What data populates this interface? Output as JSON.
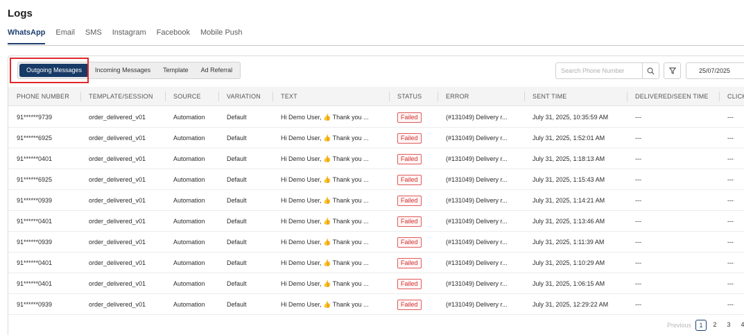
{
  "page": {
    "title": "Logs"
  },
  "channel_tabs": [
    "WhatsApp",
    "Email",
    "SMS",
    "Instagram",
    "Facebook",
    "Mobile Push"
  ],
  "sub_tabs": [
    "Outgoing Messages",
    "Incoming Messages",
    "Template",
    "Ad Referral"
  ],
  "search": {
    "placeholder": "Search Phone Number"
  },
  "date_filter": {
    "value": "25/07/2025"
  },
  "table": {
    "columns": [
      "PHONE NUMBER",
      "TEMPLATE/SESSION",
      "SOURCE",
      "VARIATION",
      "TEXT",
      "STATUS",
      "ERROR",
      "SENT TIME",
      "DELIVERED/SEEN TIME",
      "CLICK"
    ],
    "rows": [
      {
        "phone": "91******9739",
        "template": "order_delivered_v01",
        "source": "Automation",
        "variation": "Default",
        "text_pre": "Hi Demo User,",
        "emoji": "👍",
        "text_post": "Thank you ...",
        "status": "Failed",
        "error": "(#131049) Delivery r...",
        "sent": "July 31, 2025, 10:35:59 AM",
        "delivered": "---",
        "click": "---"
      },
      {
        "phone": "91******6925",
        "template": "order_delivered_v01",
        "source": "Automation",
        "variation": "Default",
        "text_pre": "Hi Demo User,",
        "emoji": "👍",
        "text_post": "Thank you ...",
        "status": "Failed",
        "error": "(#131049) Delivery r...",
        "sent": "July 31, 2025, 1:52:01 AM",
        "delivered": "---",
        "click": "---"
      },
      {
        "phone": "91******0401",
        "template": "order_delivered_v01",
        "source": "Automation",
        "variation": "Default",
        "text_pre": "Hi Demo User,",
        "emoji": "👍",
        "text_post": "Thank you ...",
        "status": "Failed",
        "error": "(#131049) Delivery r...",
        "sent": "July 31, 2025, 1:18:13 AM",
        "delivered": "---",
        "click": "---"
      },
      {
        "phone": "91******6925",
        "template": "order_delivered_v01",
        "source": "Automation",
        "variation": "Default",
        "text_pre": "Hi Demo User,",
        "emoji": "👍",
        "text_post": "Thank you ...",
        "status": "Failed",
        "error": "(#131049) Delivery r...",
        "sent": "July 31, 2025, 1:15:43 AM",
        "delivered": "---",
        "click": "---"
      },
      {
        "phone": "91******0939",
        "template": "order_delivered_v01",
        "source": "Automation",
        "variation": "Default",
        "text_pre": "Hi Demo User,",
        "emoji": "👍",
        "text_post": "Thank you ...",
        "status": "Failed",
        "error": "(#131049) Delivery r...",
        "sent": "July 31, 2025, 1:14:21 AM",
        "delivered": "---",
        "click": "---"
      },
      {
        "phone": "91******0401",
        "template": "order_delivered_v01",
        "source": "Automation",
        "variation": "Default",
        "text_pre": "Hi Demo User,",
        "emoji": "👍",
        "text_post": "Thank you ...",
        "status": "Failed",
        "error": "(#131049) Delivery r...",
        "sent": "July 31, 2025, 1:13:46 AM",
        "delivered": "---",
        "click": "---"
      },
      {
        "phone": "91******0939",
        "template": "order_delivered_v01",
        "source": "Automation",
        "variation": "Default",
        "text_pre": "Hi Demo User,",
        "emoji": "👍",
        "text_post": "Thank you ...",
        "status": "Failed",
        "error": "(#131049) Delivery r...",
        "sent": "July 31, 2025, 1:11:39 AM",
        "delivered": "---",
        "click": "---"
      },
      {
        "phone": "91******0401",
        "template": "order_delivered_v01",
        "source": "Automation",
        "variation": "Default",
        "text_pre": "Hi Demo User,",
        "emoji": "👍",
        "text_post": "Thank you ...",
        "status": "Failed",
        "error": "(#131049) Delivery r...",
        "sent": "July 31, 2025, 1:10:29 AM",
        "delivered": "---",
        "click": "---"
      },
      {
        "phone": "91******0401",
        "template": "order_delivered_v01",
        "source": "Automation",
        "variation": "Default",
        "text_pre": "Hi Demo User,",
        "emoji": "👍",
        "text_post": "Thank you ...",
        "status": "Failed",
        "error": "(#131049) Delivery r...",
        "sent": "July 31, 2025, 1:06:15 AM",
        "delivered": "---",
        "click": "---"
      },
      {
        "phone": "91******0939",
        "template": "order_delivered_v01",
        "source": "Automation",
        "variation": "Default",
        "text_pre": "Hi Demo User,",
        "emoji": "👍",
        "text_post": "Thank you ...",
        "status": "Failed",
        "error": "(#131049) Delivery r...",
        "sent": "July 31, 2025, 12:29:22 AM",
        "delivered": "---",
        "click": "---"
      }
    ]
  },
  "pagination": {
    "previous": "Previous",
    "pages": [
      "1",
      "2",
      "3",
      "4"
    ],
    "current": "1"
  },
  "colors": {
    "accent": "#173a66",
    "failed": "#d23030",
    "highlight": "#e0272b"
  }
}
